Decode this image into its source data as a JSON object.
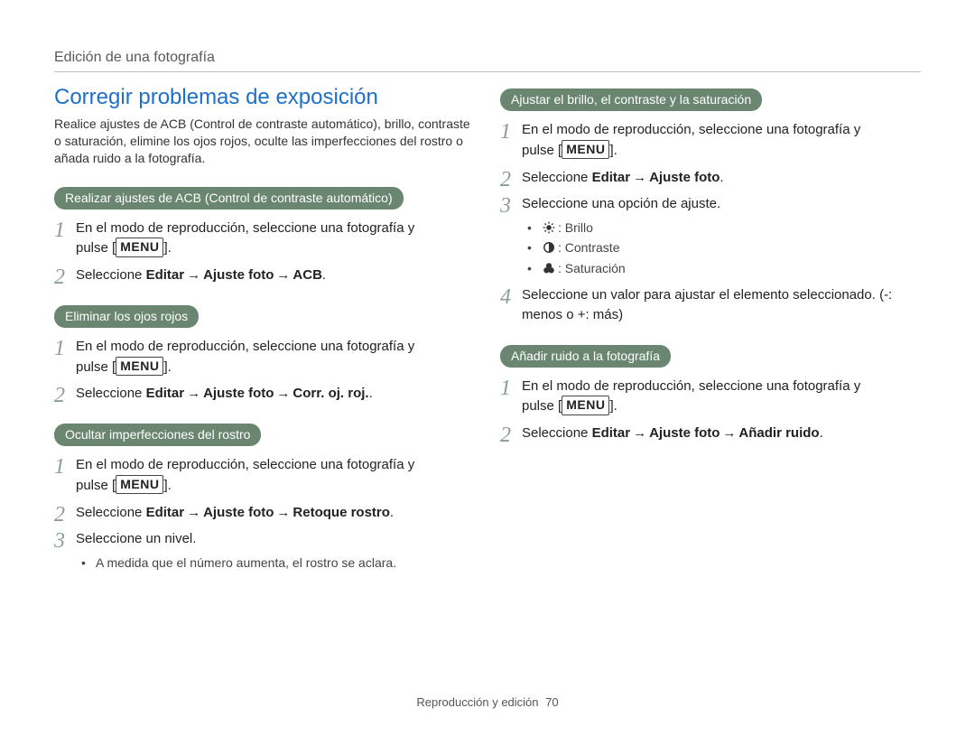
{
  "breadcrumb": "Edición de una fotografía",
  "section_title": "Corregir problemas de exposición",
  "intro": "Realice ajustes de ACB (Control de contraste automático), brillo, contraste o saturación, elimine los ojos rojos, oculte las imperfecciones del rostro o añada ruido a la fotografía.",
  "labels": {
    "menu_button": "MENU",
    "select_prefix": "Seleccione ",
    "editar": "Editar",
    "ajuste_foto": "Ajuste foto",
    "arrow": "→",
    "bracket_open": "[",
    "bracket_close": "]",
    "pulse": "pulse "
  },
  "common_step1": "En el modo de reproducción, seleccione una fotografía y",
  "left": {
    "acb": {
      "pill": "Realizar ajustes de ACB (Control de contraste automático)",
      "step2_suffix": "ACB"
    },
    "redeye": {
      "pill": "Eliminar los ojos rojos",
      "step2_suffix": "Corr. oj. roj."
    },
    "face": {
      "pill": "Ocultar imperfecciones del rostro",
      "step2_suffix": "Retoque rostro",
      "step3": "Seleccione un nivel.",
      "note": "A medida que el número aumenta, el rostro se aclara."
    }
  },
  "right": {
    "bcs": {
      "pill": "Ajustar el brillo, el contraste y la saturación",
      "step2_plain": "Ajuste foto",
      "step3": "Seleccione una opción de ajuste.",
      "opts": {
        "brillo": ": Brillo",
        "contraste": ": Contraste",
        "saturacion": ": Saturación"
      },
      "step4": "Seleccione un valor para ajustar el elemento seleccionado. (-: menos o +: más)"
    },
    "noise": {
      "pill": "Añadir ruido a la fotografía",
      "step2_suffix": "Añadir ruido"
    }
  },
  "footer": {
    "text": "Reproducción y edición",
    "page": "70"
  }
}
